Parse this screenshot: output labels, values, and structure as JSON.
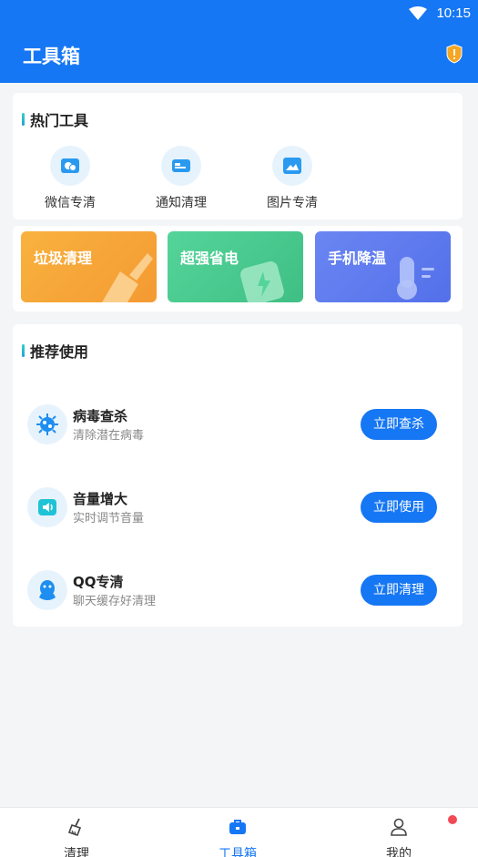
{
  "status": {
    "time": "10:15"
  },
  "header": {
    "title": "工具箱"
  },
  "hot_tools": {
    "title": "热门工具",
    "items": [
      {
        "label": "微信专清",
        "icon": "wechat-clean-icon"
      },
      {
        "label": "通知清理",
        "icon": "notification-clean-icon"
      },
      {
        "label": "图片专清",
        "icon": "image-clean-icon"
      }
    ]
  },
  "promos": [
    {
      "label": "垃圾清理",
      "icon": "broom-icon",
      "color": "#f7a73a"
    },
    {
      "label": "超强省电",
      "icon": "battery-save-icon",
      "color": "#45c98a"
    },
    {
      "label": "手机降温",
      "icon": "thermometer-icon",
      "color": "#5f7ef0"
    }
  ],
  "recommend": {
    "title": "推荐使用",
    "items": [
      {
        "title": "病毒查杀",
        "subtitle": "清除潜在病毒",
        "button": "立即查杀",
        "icon": "virus-icon"
      },
      {
        "title": "音量增大",
        "subtitle": "实时调节音量",
        "button": "立即使用",
        "icon": "volume-icon"
      },
      {
        "title": "QQ专清",
        "subtitle": "聊天缓存好清理",
        "button": "立即清理",
        "icon": "qq-icon"
      }
    ]
  },
  "bottom_nav": {
    "items": [
      {
        "label": "清理",
        "icon": "broom-icon",
        "active": false
      },
      {
        "label": "工具箱",
        "icon": "toolbox-icon",
        "active": true
      },
      {
        "label": "我的",
        "icon": "profile-icon",
        "active": false
      }
    ]
  },
  "colors": {
    "primary": "#1677f4",
    "badge": "#f24957"
  }
}
